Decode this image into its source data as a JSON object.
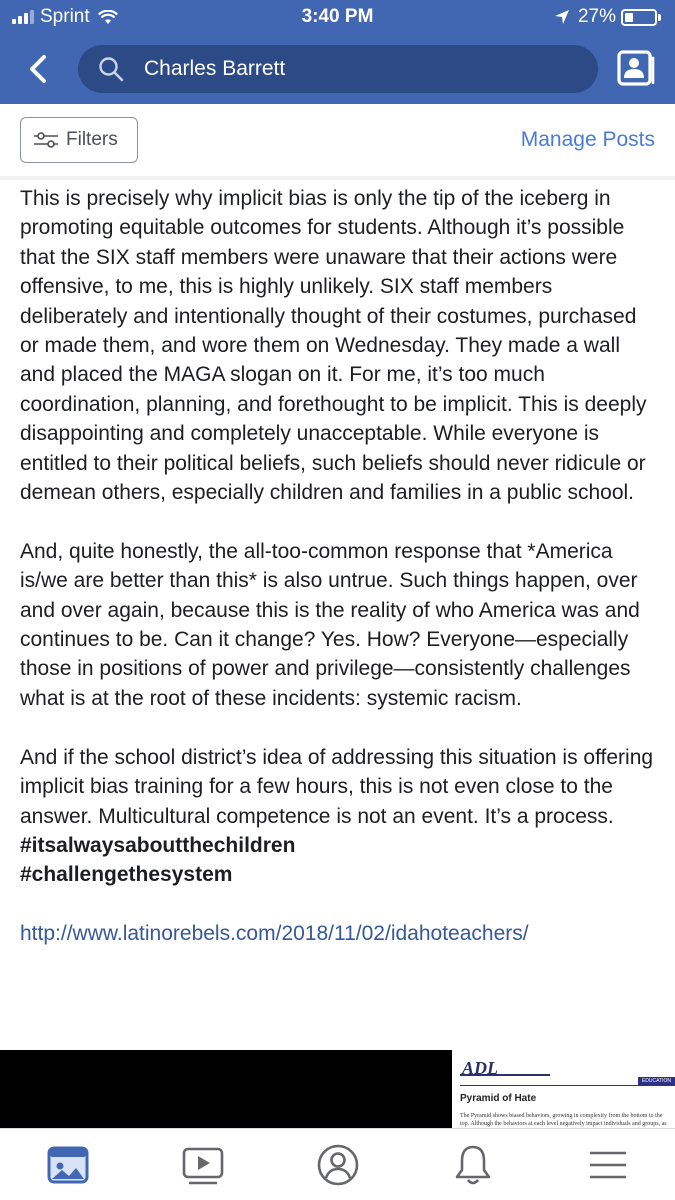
{
  "status_bar": {
    "carrier": "Sprint",
    "time": "3:40 PM",
    "battery": "27%",
    "battery_level": 0.27
  },
  "header": {
    "search_text": "Charles Barrett",
    "icons": [
      "back-arrow-icon",
      "search-icon",
      "profile-card-icon"
    ],
    "color": "#4267b2"
  },
  "toolbar": {
    "filters_label": "Filters",
    "manage_posts_label": "Manage Posts"
  },
  "post": {
    "paragraphs": [
      "This is precisely why implicit bias is only the tip of the iceberg in promoting equitable outcomes for students. Although it’s possible that the SIX staff members were unaware that their actions were offensive, to me, this is highly unlikely. SIX staff members deliberately and intentionally thought of their costumes, purchased or made them, and wore them on Wednesday. They made a wall and placed the MAGA slogan on it. For me, it’s too much coordination, planning, and forethought to be implicit. This is deeply disappointing and completely unacceptable. While everyone is entitled to their political beliefs, such beliefs should never ridicule or demean others, especially children and families in a public school.",
      "And, quite honestly, the all-too-common response that *America is/we are better than this* is also untrue. Such things happen, over and over again, because this is the reality of who America was and continues to be. Can it change? Yes. How? Everyone—especially those in positions of power and privilege—consistently challenges what is at the root of these incidents: systemic racism.",
      "And if the school district’s idea of addressing this situation is offering implicit bias training for a few hours, this is not even close to the answer. Multicultural competence is not an event. It’s a process."
    ],
    "hashtag_1": "#itsalwaysaboutthechildren",
    "hashtag_2": "#challengethesystem",
    "link": "http://www.latinorebels.com/2018/11/02/idahoteachers/"
  },
  "preview": {
    "logo": "ADL",
    "section": "EDUCATION",
    "title": "Pyramid of Hate",
    "body": "The Pyramid shows biased behaviors, growing in complexity from the bottom to the top. Although the behaviors at each level negatively impact individuals and groups, as one moves up the pyramid,"
  },
  "tabbar": {
    "items": [
      "news-feed-icon",
      "watch-icon",
      "profile-icon",
      "notifications-icon",
      "menu-icon"
    ],
    "active": "news-feed-icon",
    "active_color": "#4267b2",
    "inactive_color": "#65676b"
  }
}
